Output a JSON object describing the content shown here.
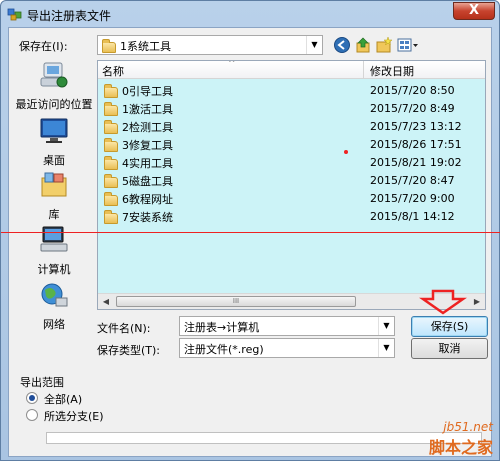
{
  "window": {
    "title": "导出注册表文件",
    "close_symbol": "X"
  },
  "save_in": {
    "label": "保存在(I):",
    "value": "1系统工具"
  },
  "places": [
    {
      "label": "最近访问的位置",
      "icon": "recent-places-icon"
    },
    {
      "label": "桌面",
      "icon": "desktop-icon"
    },
    {
      "label": "库",
      "icon": "library-icon"
    },
    {
      "label": "计算机",
      "icon": "computer-icon"
    },
    {
      "label": "网络",
      "icon": "network-icon"
    }
  ],
  "file_list": {
    "col_name": "名称",
    "col_date": "修改日期",
    "rows": [
      {
        "name": "0引导工具",
        "date": "2015/7/20 8:50"
      },
      {
        "name": "1激活工具",
        "date": "2015/7/20 8:49"
      },
      {
        "name": "2检测工具",
        "date": "2015/7/23 13:12"
      },
      {
        "name": "3修复工具",
        "date": "2015/8/26 17:51"
      },
      {
        "name": "4实用工具",
        "date": "2015/8/21 19:02"
      },
      {
        "name": "5磁盘工具",
        "date": "2015/7/20 8:47"
      },
      {
        "name": "6教程网址",
        "date": "2015/7/20 9:00"
      },
      {
        "name": "7安装系统",
        "date": "2015/8/1 14:12"
      }
    ],
    "scroll_grip": "III"
  },
  "filename": {
    "label": "文件名(N):",
    "value": "注册表→计算机"
  },
  "filetype": {
    "label": "保存类型(T):",
    "value": "注册文件(*.reg)"
  },
  "buttons": {
    "save": "保存(S)",
    "cancel": "取消"
  },
  "export_range": {
    "title": "导出范围",
    "all": "全部(A)",
    "branch": "所选分支(E)"
  },
  "watermark": {
    "line1": "jb51.net",
    "line2": "脚本之家"
  },
  "colors": {
    "list_bg": "#ccf3f7",
    "annotation_red": "#e22222",
    "watermark": "#e06a1f"
  }
}
